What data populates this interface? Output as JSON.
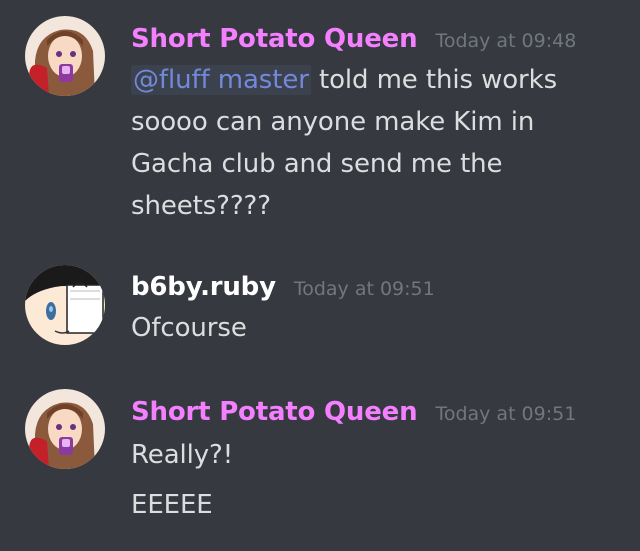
{
  "messages": [
    {
      "username": "Short Potato Queen",
      "timestamp": "Today at 09:48",
      "mention": "@fluff master",
      "lines": [
        " told me this works",
        "soooo can anyone make Kim in",
        "Gacha club and send me the",
        "sheets????"
      ]
    },
    {
      "username": "b6by.ruby",
      "timestamp": "Today at 09:51",
      "lines": [
        "Ofcourse"
      ]
    },
    {
      "username": "Short Potato Queen",
      "timestamp": "Today at 09:51",
      "lines": [
        "Really?!",
        "EEEEE"
      ]
    }
  ],
  "colors": {
    "background": "#36393f",
    "username_pink": "#f47fff",
    "username_white": "#ffffff",
    "timestamp": "#72767d",
    "text": "#dcddde",
    "mention": "#7289da"
  }
}
